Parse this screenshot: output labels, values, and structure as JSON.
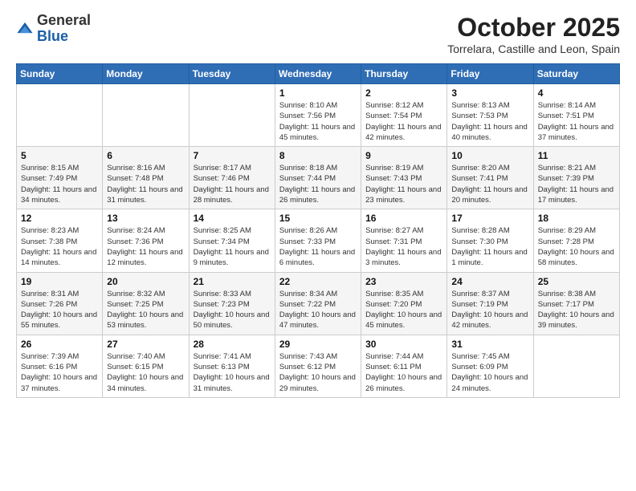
{
  "header": {
    "logo_general": "General",
    "logo_blue": "Blue",
    "month_title": "October 2025",
    "location": "Torrelara, Castille and Leon, Spain"
  },
  "days_of_week": [
    "Sunday",
    "Monday",
    "Tuesday",
    "Wednesday",
    "Thursday",
    "Friday",
    "Saturday"
  ],
  "weeks": [
    [
      {
        "day": "",
        "info": ""
      },
      {
        "day": "",
        "info": ""
      },
      {
        "day": "",
        "info": ""
      },
      {
        "day": "1",
        "info": "Sunrise: 8:10 AM\nSunset: 7:56 PM\nDaylight: 11 hours and 45 minutes."
      },
      {
        "day": "2",
        "info": "Sunrise: 8:12 AM\nSunset: 7:54 PM\nDaylight: 11 hours and 42 minutes."
      },
      {
        "day": "3",
        "info": "Sunrise: 8:13 AM\nSunset: 7:53 PM\nDaylight: 11 hours and 40 minutes."
      },
      {
        "day": "4",
        "info": "Sunrise: 8:14 AM\nSunset: 7:51 PM\nDaylight: 11 hours and 37 minutes."
      }
    ],
    [
      {
        "day": "5",
        "info": "Sunrise: 8:15 AM\nSunset: 7:49 PM\nDaylight: 11 hours and 34 minutes."
      },
      {
        "day": "6",
        "info": "Sunrise: 8:16 AM\nSunset: 7:48 PM\nDaylight: 11 hours and 31 minutes."
      },
      {
        "day": "7",
        "info": "Sunrise: 8:17 AM\nSunset: 7:46 PM\nDaylight: 11 hours and 28 minutes."
      },
      {
        "day": "8",
        "info": "Sunrise: 8:18 AM\nSunset: 7:44 PM\nDaylight: 11 hours and 26 minutes."
      },
      {
        "day": "9",
        "info": "Sunrise: 8:19 AM\nSunset: 7:43 PM\nDaylight: 11 hours and 23 minutes."
      },
      {
        "day": "10",
        "info": "Sunrise: 8:20 AM\nSunset: 7:41 PM\nDaylight: 11 hours and 20 minutes."
      },
      {
        "day": "11",
        "info": "Sunrise: 8:21 AM\nSunset: 7:39 PM\nDaylight: 11 hours and 17 minutes."
      }
    ],
    [
      {
        "day": "12",
        "info": "Sunrise: 8:23 AM\nSunset: 7:38 PM\nDaylight: 11 hours and 14 minutes."
      },
      {
        "day": "13",
        "info": "Sunrise: 8:24 AM\nSunset: 7:36 PM\nDaylight: 11 hours and 12 minutes."
      },
      {
        "day": "14",
        "info": "Sunrise: 8:25 AM\nSunset: 7:34 PM\nDaylight: 11 hours and 9 minutes."
      },
      {
        "day": "15",
        "info": "Sunrise: 8:26 AM\nSunset: 7:33 PM\nDaylight: 11 hours and 6 minutes."
      },
      {
        "day": "16",
        "info": "Sunrise: 8:27 AM\nSunset: 7:31 PM\nDaylight: 11 hours and 3 minutes."
      },
      {
        "day": "17",
        "info": "Sunrise: 8:28 AM\nSunset: 7:30 PM\nDaylight: 11 hours and 1 minute."
      },
      {
        "day": "18",
        "info": "Sunrise: 8:29 AM\nSunset: 7:28 PM\nDaylight: 10 hours and 58 minutes."
      }
    ],
    [
      {
        "day": "19",
        "info": "Sunrise: 8:31 AM\nSunset: 7:26 PM\nDaylight: 10 hours and 55 minutes."
      },
      {
        "day": "20",
        "info": "Sunrise: 8:32 AM\nSunset: 7:25 PM\nDaylight: 10 hours and 53 minutes."
      },
      {
        "day": "21",
        "info": "Sunrise: 8:33 AM\nSunset: 7:23 PM\nDaylight: 10 hours and 50 minutes."
      },
      {
        "day": "22",
        "info": "Sunrise: 8:34 AM\nSunset: 7:22 PM\nDaylight: 10 hours and 47 minutes."
      },
      {
        "day": "23",
        "info": "Sunrise: 8:35 AM\nSunset: 7:20 PM\nDaylight: 10 hours and 45 minutes."
      },
      {
        "day": "24",
        "info": "Sunrise: 8:37 AM\nSunset: 7:19 PM\nDaylight: 10 hours and 42 minutes."
      },
      {
        "day": "25",
        "info": "Sunrise: 8:38 AM\nSunset: 7:17 PM\nDaylight: 10 hours and 39 minutes."
      }
    ],
    [
      {
        "day": "26",
        "info": "Sunrise: 7:39 AM\nSunset: 6:16 PM\nDaylight: 10 hours and 37 minutes."
      },
      {
        "day": "27",
        "info": "Sunrise: 7:40 AM\nSunset: 6:15 PM\nDaylight: 10 hours and 34 minutes."
      },
      {
        "day": "28",
        "info": "Sunrise: 7:41 AM\nSunset: 6:13 PM\nDaylight: 10 hours and 31 minutes."
      },
      {
        "day": "29",
        "info": "Sunrise: 7:43 AM\nSunset: 6:12 PM\nDaylight: 10 hours and 29 minutes."
      },
      {
        "day": "30",
        "info": "Sunrise: 7:44 AM\nSunset: 6:11 PM\nDaylight: 10 hours and 26 minutes."
      },
      {
        "day": "31",
        "info": "Sunrise: 7:45 AM\nSunset: 6:09 PM\nDaylight: 10 hours and 24 minutes."
      },
      {
        "day": "",
        "info": ""
      }
    ]
  ]
}
